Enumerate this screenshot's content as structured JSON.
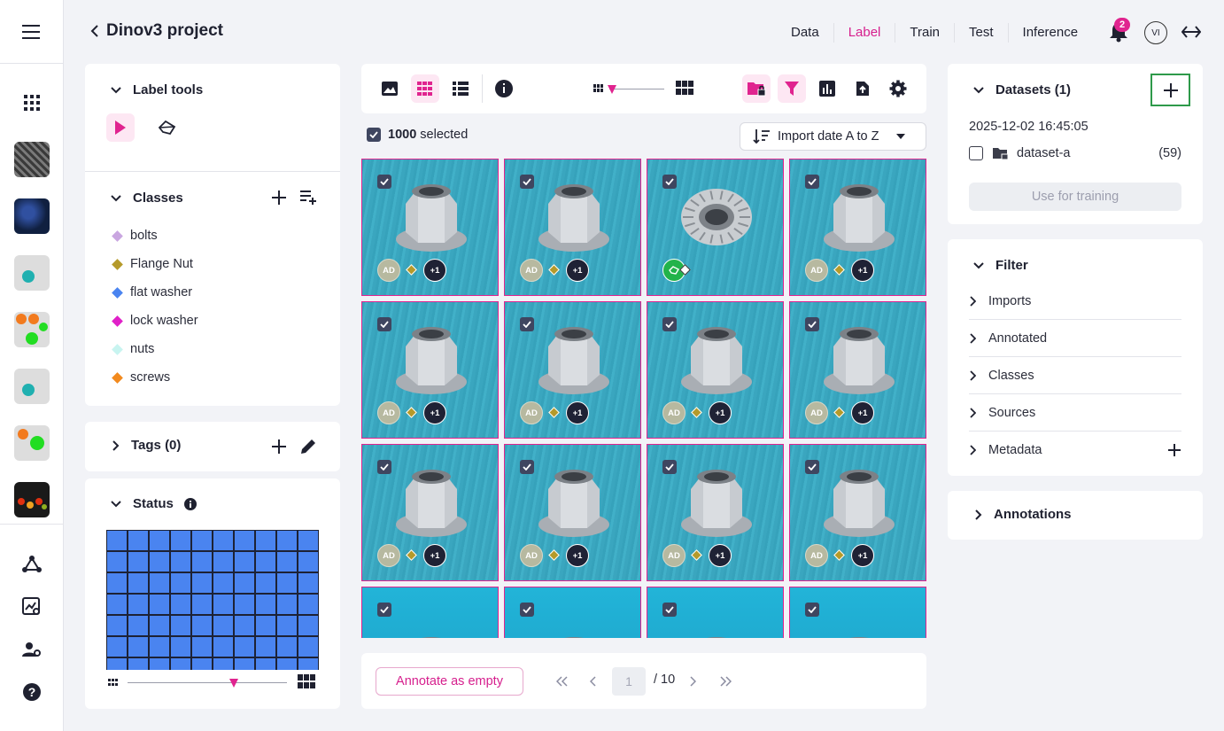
{
  "header": {
    "project_title": "Dinov3 project",
    "nav": [
      "Data",
      "Label",
      "Train",
      "Test",
      "Inference"
    ],
    "active_nav": "Label",
    "notification_count": "2",
    "user_initials": "VI"
  },
  "label_tools": {
    "title": "Label tools",
    "tools": [
      "pointer-tool",
      "polygon-tool"
    ]
  },
  "classes": {
    "title": "Classes",
    "items": [
      {
        "label": "bolts",
        "color": "#c9a6e0"
      },
      {
        "label": "Flange Nut",
        "color": "#b59a2a"
      },
      {
        "label": "flat washer",
        "color": "#4a84f0"
      },
      {
        "label": "lock washer",
        "color": "#e020c8"
      },
      {
        "label": "nuts",
        "color": "#c8f4f0"
      },
      {
        "label": "screws",
        "color": "#f28a1e"
      }
    ]
  },
  "tags": {
    "title": "Tags (0)"
  },
  "status": {
    "title": "Status"
  },
  "selection": {
    "count": "1000",
    "suffix": "selected"
  },
  "sort": {
    "label": "Import date A to Z"
  },
  "tiles": [
    {
      "ad": "AD",
      "plus": "+1",
      "variant": "default"
    },
    {
      "ad": "AD",
      "plus": "+1",
      "variant": "default"
    },
    {
      "ad": "",
      "plus": "",
      "variant": "serrated"
    },
    {
      "ad": "AD",
      "plus": "+1",
      "variant": "default"
    },
    {
      "ad": "AD",
      "plus": "+1",
      "variant": "default"
    },
    {
      "ad": "AD",
      "plus": "+1",
      "variant": "default"
    },
    {
      "ad": "AD",
      "plus": "+1",
      "variant": "default"
    },
    {
      "ad": "AD",
      "plus": "+1",
      "variant": "default"
    },
    {
      "ad": "AD",
      "plus": "+1",
      "variant": "default"
    },
    {
      "ad": "AD",
      "plus": "+1",
      "variant": "default"
    },
    {
      "ad": "AD",
      "plus": "+1",
      "variant": "default"
    },
    {
      "ad": "AD",
      "plus": "+1",
      "variant": "default"
    },
    {
      "ad": "",
      "plus": "",
      "variant": "default"
    },
    {
      "ad": "",
      "plus": "",
      "variant": "default"
    },
    {
      "ad": "",
      "plus": "",
      "variant": "default"
    },
    {
      "ad": "",
      "plus": "",
      "variant": "default"
    }
  ],
  "pager": {
    "annotate_empty": "Annotate as empty",
    "current_page": "1",
    "total": "/ 10"
  },
  "datasets": {
    "title": "Datasets (1)",
    "date": "2025-12-02 16:45:05",
    "items": [
      {
        "name": "dataset-a",
        "count": "(59)"
      }
    ],
    "use_for_training": "Use for training"
  },
  "filter": {
    "title": "Filter",
    "items": [
      "Imports",
      "Annotated",
      "Classes",
      "Sources",
      "Metadata"
    ]
  },
  "annotations": {
    "title": "Annotations"
  },
  "colors": {
    "accent": "#d61f8d",
    "status_cell": "#4a84f0"
  }
}
